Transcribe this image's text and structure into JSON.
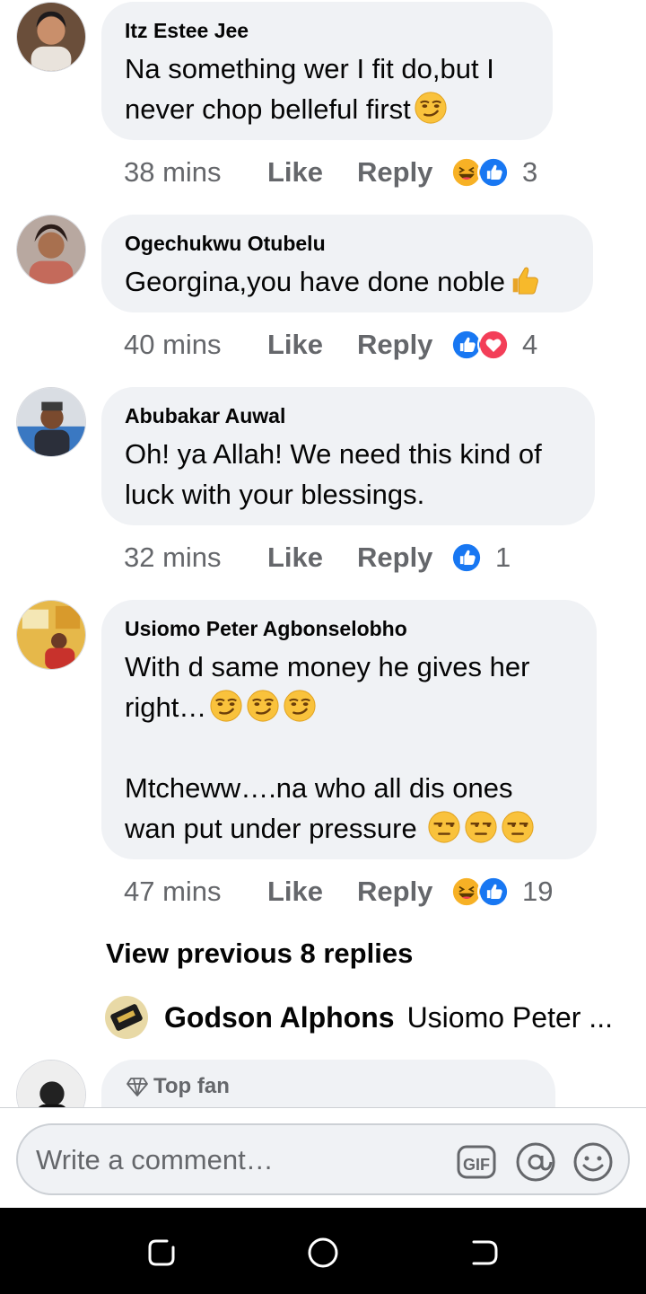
{
  "comments": [
    {
      "author": "Itz Estee Jee",
      "lines": [
        "Na something wer I fit do,but I",
        "never chop belleful first"
      ],
      "time": "38 mins",
      "like_label": "Like",
      "reply_label": "Reply",
      "reactions": [
        "haha-reaction",
        "like-reaction"
      ],
      "reaction_count": "3"
    },
    {
      "author": "Ogechukwu Otubelu",
      "lines": [
        "Georgina,you have done noble"
      ],
      "time": "40 mins",
      "like_label": "Like",
      "reply_label": "Reply",
      "reactions": [
        "like-reaction",
        "love-reaction"
      ],
      "reaction_count": "4"
    },
    {
      "author": "Abubakar Auwal",
      "lines": [
        "Oh! ya Allah! We need this kind of",
        "luck with your blessings."
      ],
      "time": "32 mins",
      "like_label": "Like",
      "reply_label": "Reply",
      "reactions": [
        "like-reaction"
      ],
      "reaction_count": "1"
    },
    {
      "author": "Usiomo Peter Agbonselobho",
      "lines": [
        "With d same money he gives her",
        "right…",
        "",
        "Mtcheww….na who all dis ones",
        "wan put under pressure"
      ],
      "time": "47 mins",
      "like_label": "Like",
      "reply_label": "Reply",
      "reactions": [
        "haha-reaction",
        "like-reaction"
      ],
      "reaction_count": "19"
    }
  ],
  "view_previous": "View previous 8 replies",
  "latest_reply": {
    "author": "Godson Alphons",
    "snippet": "Usiomo Peter ..."
  },
  "next_comment": {
    "badge": "Top fan"
  },
  "composer": {
    "placeholder": "Write a comment…",
    "gif_label": "GIF"
  },
  "colors": {
    "bubble": "#f0f2f5",
    "meta_text": "#65676b",
    "like_blue": "#1877f2",
    "love_red": "#f33e58",
    "haha_yellow": "#f7b125"
  }
}
